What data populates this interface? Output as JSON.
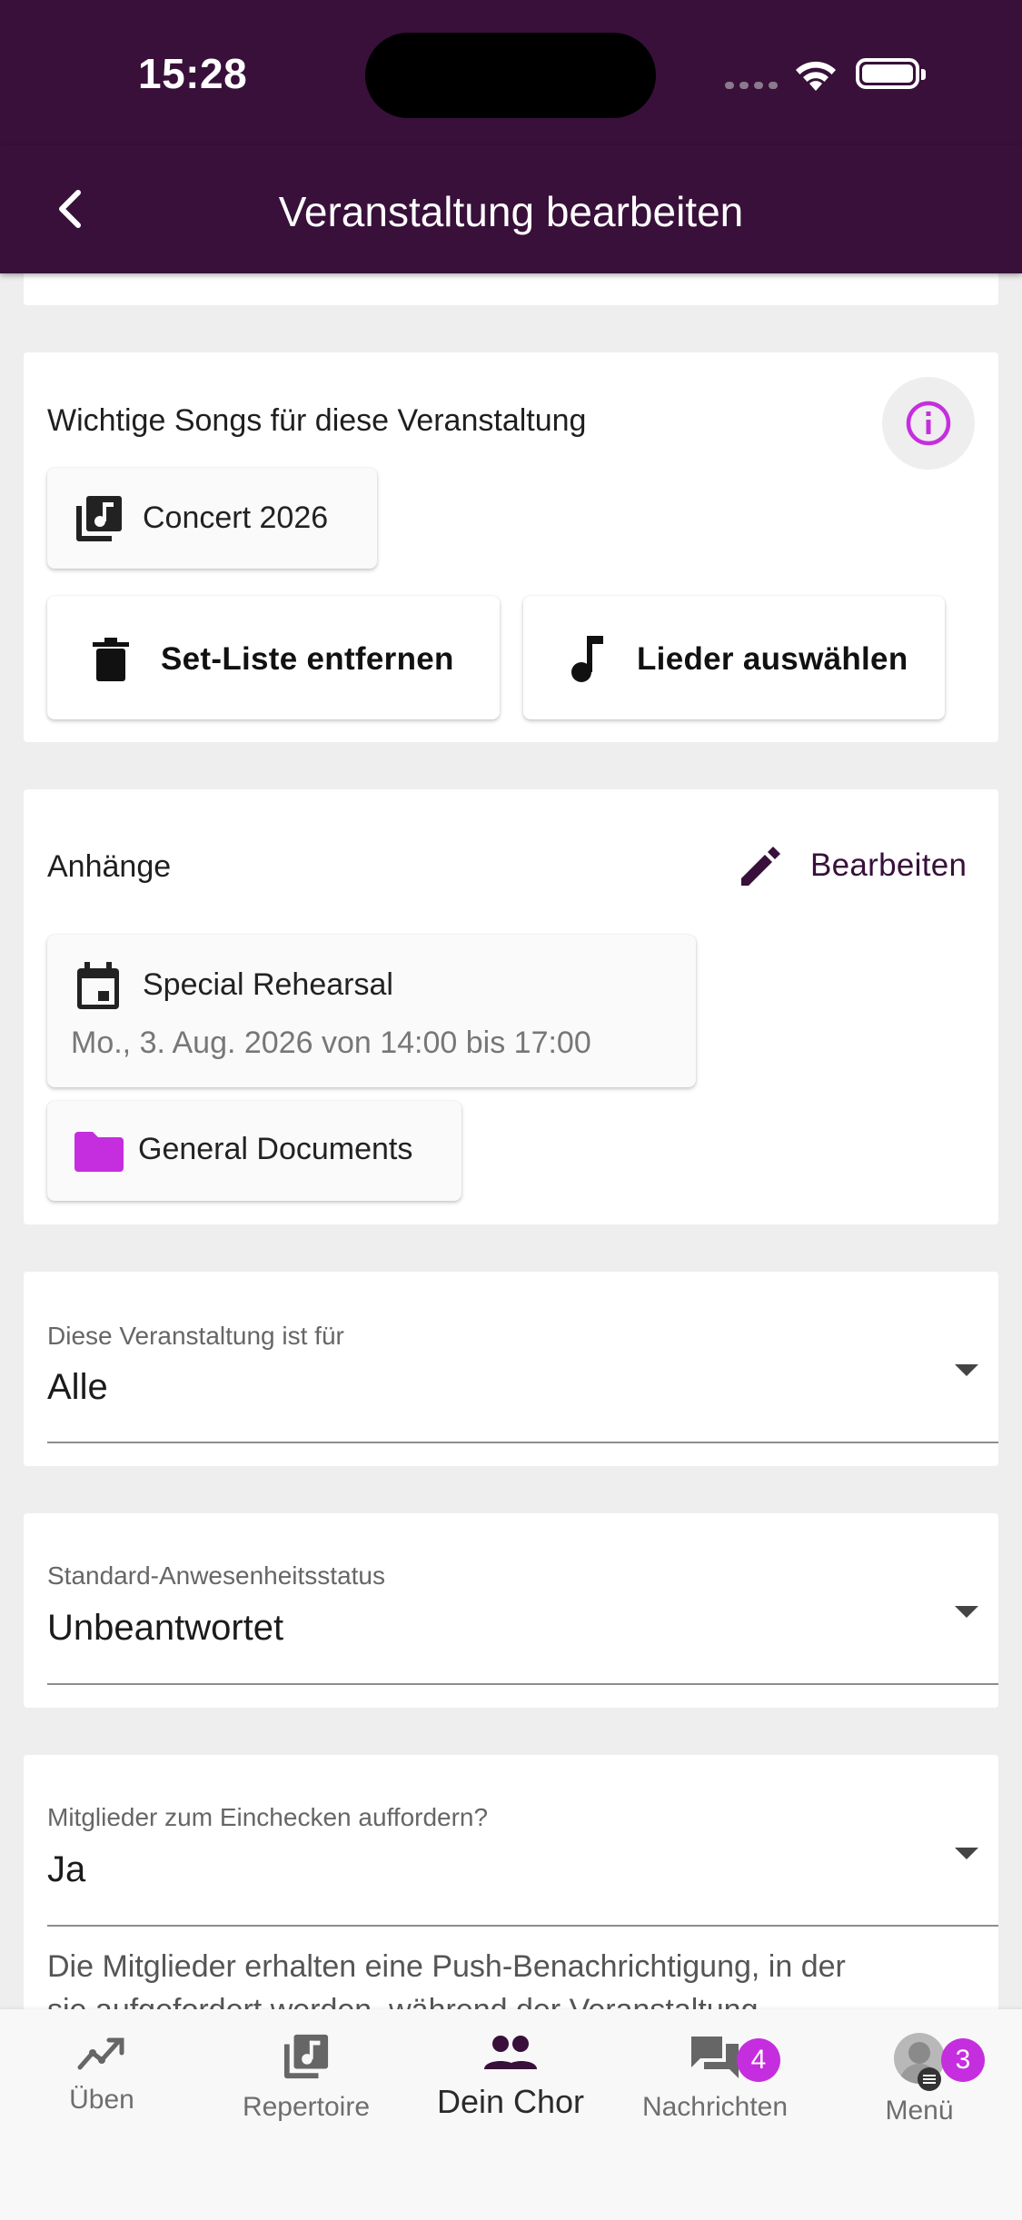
{
  "status_bar": {
    "time": "15:28"
  },
  "app_bar": {
    "title": "Veranstaltung bearbeiten"
  },
  "songs": {
    "title": "Wichtige Songs für diese Veranstaltung",
    "setlist_chip": "Concert 2026",
    "remove_button": "Set-Liste entfernen",
    "select_button": "Lieder auswählen"
  },
  "attachments": {
    "title": "Anhänge",
    "edit_button": "Bearbeiten",
    "event_chip": {
      "title": "Special Rehearsal",
      "subtitle": "Mo., 3. Aug. 2026 von 14:00 bis 17:00"
    },
    "folder_chip": "General Documents"
  },
  "audience": {
    "label": "Diese Veranstaltung ist für",
    "value": "Alle"
  },
  "attendance": {
    "label": "Standard-Anwesenheitsstatus",
    "value": "Unbeantwortet"
  },
  "checkin": {
    "label": "Mitglieder zum Einchecken auffordern?",
    "value": "Ja",
    "helper_line1": "Die Mitglieder erhalten eine Push-Benachrichtigung, in der",
    "helper_line2": "sie aufgefordert werden, während der Veranstaltung"
  },
  "bottom_nav": {
    "items": [
      {
        "label": "Üben"
      },
      {
        "label": "Repertoire"
      },
      {
        "label": "Dein Chor"
      },
      {
        "label": "Nachrichten",
        "badge": "4"
      },
      {
        "label": "Menü",
        "badge": "3"
      }
    ],
    "active_index": 2
  },
  "colors": {
    "primary": "#38103a",
    "accent": "#c52ede",
    "background": "#eeeeee"
  }
}
